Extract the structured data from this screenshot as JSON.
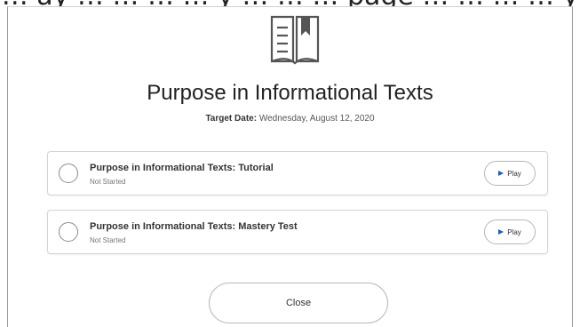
{
  "background": {
    "text": "… ay … … … … y … … … page … … … … y"
  },
  "dialog": {
    "icon": "open-book-bookmark-icon",
    "title": "Purpose in Informational Texts",
    "target_label": "Target Date:",
    "target_value": "Wednesday, August 12, 2020",
    "activities": [
      {
        "title": "Purpose in Informational Texts: Tutorial",
        "status": "Not Started",
        "play_label": "Play"
      },
      {
        "title": "Purpose in Informational Texts: Mastery Test",
        "status": "Not Started",
        "play_label": "Play"
      }
    ],
    "close_label": "Close"
  },
  "colors": {
    "accent": "#1b5fc2",
    "border": "#d4d4d4",
    "text": "#222222"
  }
}
